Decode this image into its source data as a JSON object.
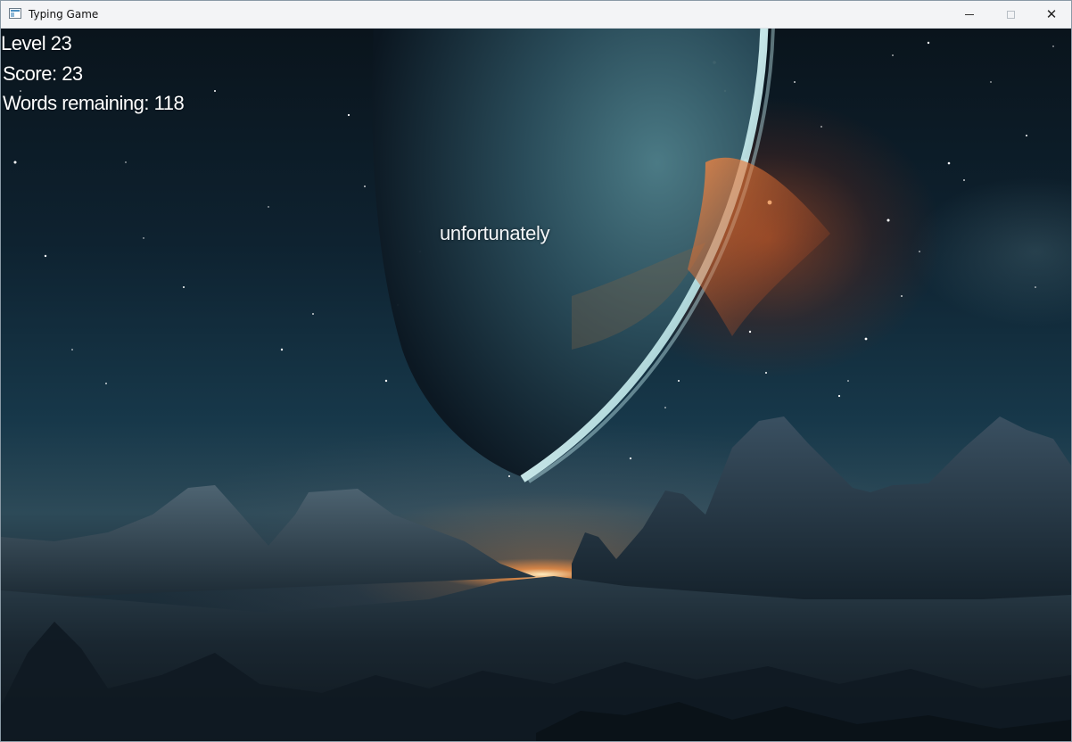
{
  "window": {
    "title": "Typing Game",
    "controls": {
      "minimize_icon": "minimize-icon",
      "maximize_icon": "maximize-icon",
      "close_icon": "close-icon",
      "close_glyph": "✕"
    }
  },
  "hud": {
    "level": "Level 23",
    "score": "Score: 23",
    "words_remaining": "Words remaining: 118"
  },
  "game": {
    "current_word": "unfortunately"
  },
  "colors": {
    "hud_text": "#ffffff",
    "sky_top": "#0a141c",
    "planet_rim": "#dff3f4",
    "sun_glow": "#ff9a4a"
  }
}
